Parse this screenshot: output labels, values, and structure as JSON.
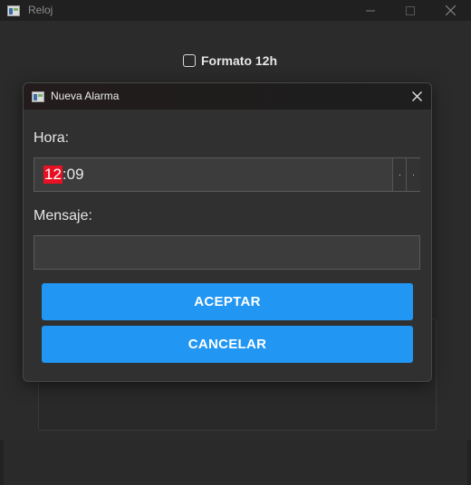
{
  "window": {
    "title": "Reloj"
  },
  "settings": {
    "format_label": "Formato 12h",
    "format_checked": false
  },
  "dialog": {
    "title": "Nueva Alarma",
    "hour_label": "Hora:",
    "time": {
      "hour": "12",
      "separator": ":",
      "minute": "09"
    },
    "message_label": "Mensaje:",
    "message_value": "",
    "accept_label": "ACEPTAR",
    "cancel_label": "CANCELAR"
  },
  "colors": {
    "accent": "#2196f3",
    "selection": "#e81123",
    "background": "#2b2b2b"
  },
  "icons": {
    "app": "app-window-icon",
    "minimize": "minimize-icon",
    "maximize": "maximize-icon",
    "close": "close-icon"
  }
}
